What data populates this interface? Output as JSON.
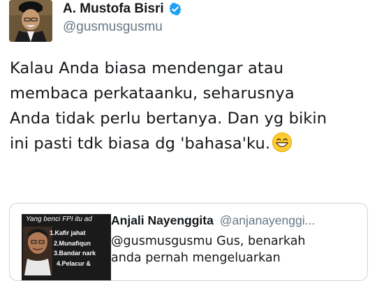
{
  "author": {
    "display_name": "A. Mustofa Bisri",
    "handle": "@gusmusgusmu",
    "verified": true,
    "avatar_icon": "profile-photo"
  },
  "tweet": {
    "lines": [
      "Kalau Anda biasa mendengar atau",
      "membaca perkataanku, seharusnya",
      "Anda tidak perlu bertanya.  Dan yg bikin",
      "ini pasti tdk biasa dg 'bahasa'ku."
    ],
    "emoji": "grinning-face-with-smiling-eyes"
  },
  "quoted_tweet": {
    "display_name": "Anjali Nayenggita",
    "handle": "@anjanayenggi...",
    "text_lines": [
      "@gusmusgusmu Gus, benarkah",
      "anda pernah mengeluarkan"
    ],
    "media": {
      "title": "Yang benci FPI itu ad",
      "items": [
        "1.Kafir jahat",
        "2.Munafiqun",
        "3.Bandar nark",
        "4.Pelacur &"
      ]
    }
  },
  "colors": {
    "text": "#14171a",
    "secondary": "#657786",
    "verified": "#1da1f2",
    "border": "#ccd6dd"
  }
}
